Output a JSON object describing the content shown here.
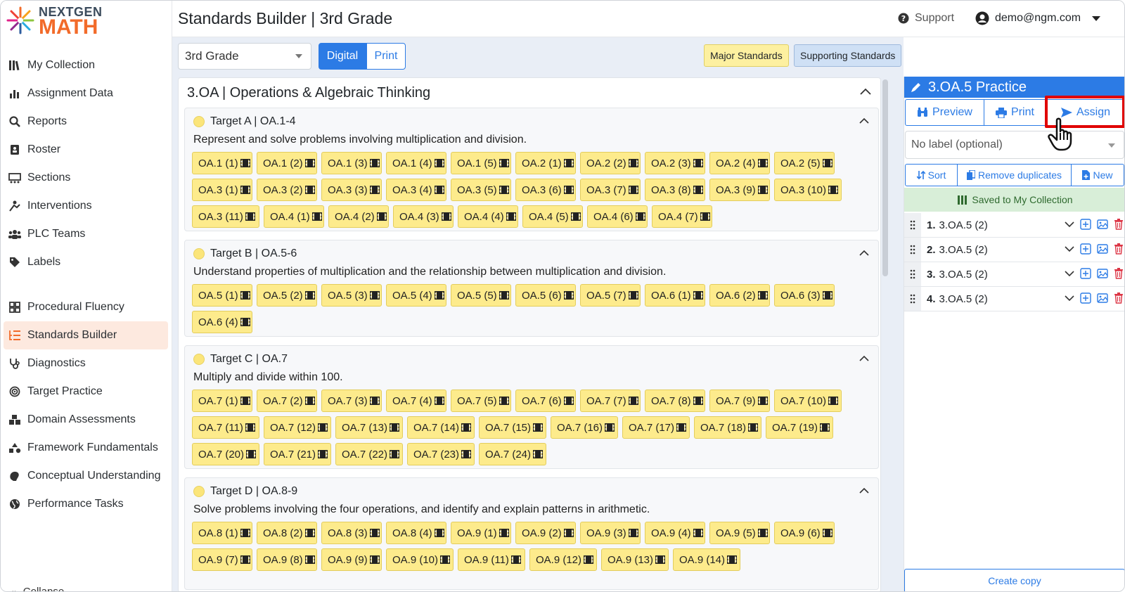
{
  "header": {
    "title": "Standards Builder | 3rd Grade",
    "support": "Support",
    "user_email": "demo@ngm.com"
  },
  "logo": {
    "top": "NEXTGEN",
    "bottom": "MATH"
  },
  "sidebar": {
    "group1": [
      {
        "label": "My Collection",
        "icon": "books-icon"
      },
      {
        "label": "Assignment Data",
        "icon": "bar-chart-icon"
      },
      {
        "label": "Reports",
        "icon": "search-report-icon"
      },
      {
        "label": "Roster",
        "icon": "roster-icon"
      },
      {
        "label": "Sections",
        "icon": "sections-icon"
      },
      {
        "label": "Interventions",
        "icon": "interventions-icon"
      },
      {
        "label": "PLC Teams",
        "icon": "users-icon"
      },
      {
        "label": "Labels",
        "icon": "tag-icon"
      }
    ],
    "group2": [
      {
        "label": "Procedural Fluency",
        "icon": "grid-icon"
      },
      {
        "label": "Standards Builder",
        "icon": "list-tree-icon",
        "active": true
      },
      {
        "label": "Diagnostics",
        "icon": "stethoscope-icon"
      },
      {
        "label": "Target Practice",
        "icon": "target-icon"
      },
      {
        "label": "Domain Assessments",
        "icon": "cubes-icon"
      },
      {
        "label": "Framework Fundamentals",
        "icon": "shapes-icon"
      },
      {
        "label": "Conceptual Understanding",
        "icon": "brain-icon"
      },
      {
        "label": "Performance Tasks",
        "icon": "globe-icon"
      }
    ],
    "collapse_label": "Collapse"
  },
  "toolbar": {
    "grade_select": "3rd Grade",
    "digital": "Digital",
    "print": "Print",
    "major": "Major Standards",
    "supporting": "Supporting Standards"
  },
  "domain": {
    "title": "3.OA | Operations & Algebraic Thinking"
  },
  "targets": [
    {
      "title": "Target A | OA.1-4",
      "desc": "Represent and solve problems involving multiplication and division.",
      "chips": [
        "OA.1 (1)",
        "OA.1 (2)",
        "OA.1 (3)",
        "OA.1 (4)",
        "OA.1 (5)",
        "OA.2 (1)",
        "OA.2 (2)",
        "OA.2 (3)",
        "OA.2 (4)",
        "OA.2 (5)",
        "OA.3 (1)",
        "OA.3 (2)",
        "OA.3 (3)",
        "OA.3 (4)",
        "OA.3 (5)",
        "OA.3 (6)",
        "OA.3 (7)",
        "OA.3 (8)",
        "OA.3 (9)",
        "OA.3 (10)",
        "OA.3 (11)",
        "OA.4 (1)",
        "OA.4 (2)",
        "OA.4 (3)",
        "OA.4 (4)",
        "OA.4 (5)",
        "OA.4 (6)",
        "OA.4 (7)"
      ]
    },
    {
      "title": "Target B | OA.5-6",
      "desc": "Understand properties of multiplication and the relationship between multiplication and division.",
      "chips": [
        "OA.5 (1)",
        "OA.5 (2)",
        "OA.5 (3)",
        "OA.5 (4)",
        "OA.5 (5)",
        "OA.5 (6)",
        "OA.5 (7)",
        "OA.6 (1)",
        "OA.6 (2)",
        "OA.6 (3)",
        "OA.6 (4)"
      ]
    },
    {
      "title": "Target C | OA.7",
      "desc": "Multiply and divide within 100.",
      "chips": [
        "OA.7 (1)",
        "OA.7 (2)",
        "OA.7 (3)",
        "OA.7 (4)",
        "OA.7 (5)",
        "OA.7 (6)",
        "OA.7 (7)",
        "OA.7 (8)",
        "OA.7 (9)",
        "OA.7 (10)",
        "OA.7 (11)",
        "OA.7 (12)",
        "OA.7 (13)",
        "OA.7 (14)",
        "OA.7 (15)",
        "OA.7 (16)",
        "OA.7 (17)",
        "OA.7 (18)",
        "OA.7 (19)",
        "OA.7 (20)",
        "OA.7 (21)",
        "OA.7 (22)",
        "OA.7 (23)",
        "OA.7 (24)"
      ]
    },
    {
      "title": "Target D | OA.8-9",
      "desc": "Solve problems involving the four operations, and identify and explain patterns in arithmetic.",
      "chips": [
        "OA.8 (1)",
        "OA.8 (2)",
        "OA.8 (3)",
        "OA.8 (4)",
        "OA.9 (1)",
        "OA.9 (2)",
        "OA.9 (3)",
        "OA.9 (4)",
        "OA.9 (5)",
        "OA.9 (6)",
        "OA.9 (7)",
        "OA.9 (8)",
        "OA.9 (9)",
        "OA.9 (10)",
        "OA.9 (11)",
        "OA.9 (12)",
        "OA.9 (13)",
        "OA.9 (14)"
      ]
    }
  ],
  "practice": {
    "title": "3.OA.5 Practice",
    "preview": "Preview",
    "print": "Print",
    "assign": "Assign",
    "label_placeholder": "No label (optional)",
    "sort": "Sort",
    "remove_duplicates": "Remove duplicates",
    "new": "New",
    "saved": "Saved to My Collection",
    "items": [
      {
        "num": "1.",
        "name": "3.OA.5 (2)"
      },
      {
        "num": "2.",
        "name": "3.OA.5 (2)"
      },
      {
        "num": "3.",
        "name": "3.OA.5 (2)"
      },
      {
        "num": "4.",
        "name": "3.OA.5 (2)"
      }
    ],
    "create_copy": "Create copy"
  },
  "colors": {
    "accent": "#2c7be5",
    "brand_orange": "#f26b2a",
    "chip": "#fdeb8c",
    "highlight": "#e00000",
    "saved_bg": "#d8eed8"
  }
}
